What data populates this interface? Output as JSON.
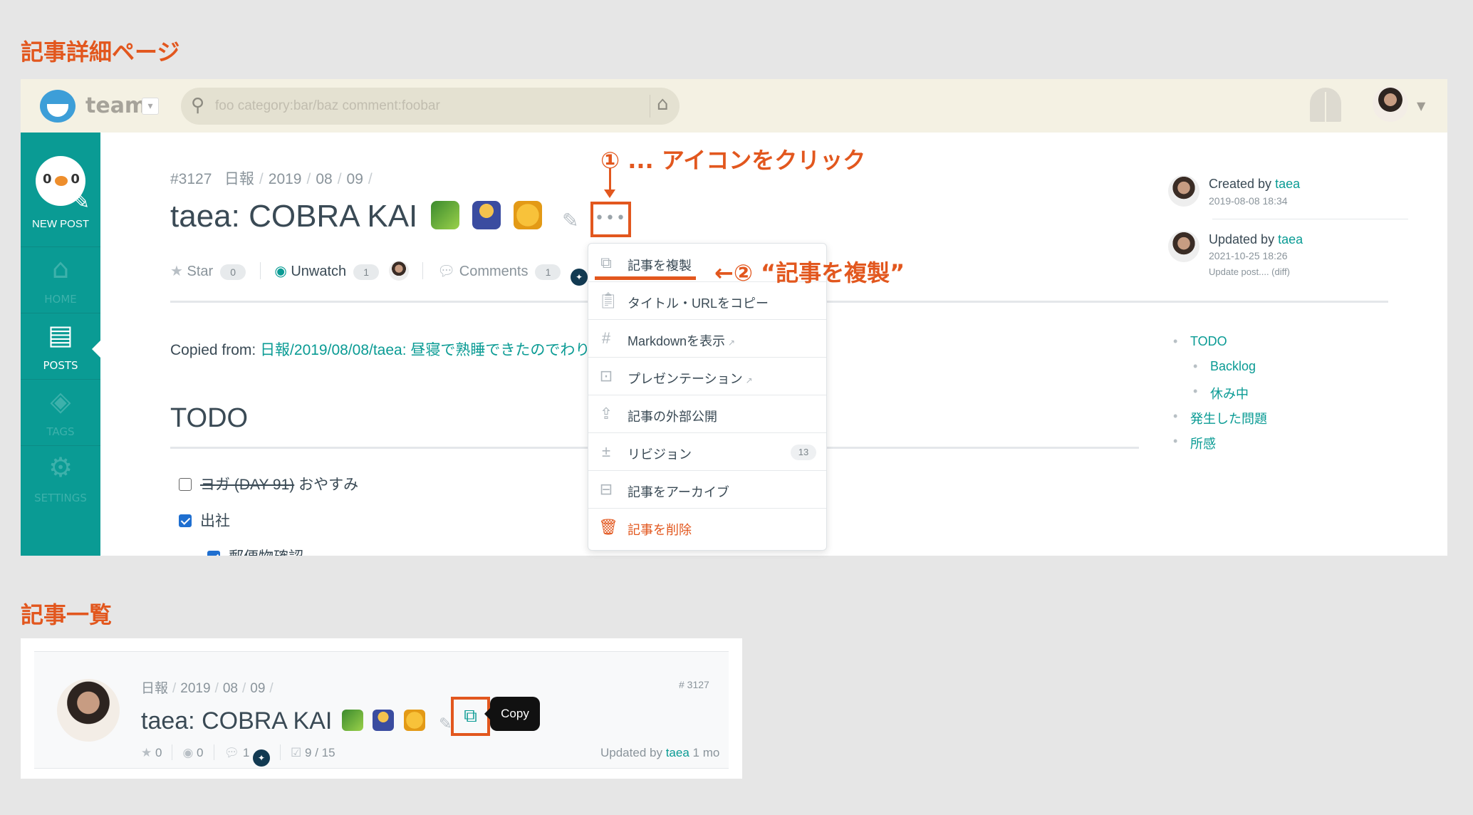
{
  "sections": {
    "detail_title": "記事詳細ページ",
    "list_title": "記事一覧"
  },
  "header": {
    "team": "team",
    "search_placeholder": "foo category:bar/baz comment:foobar"
  },
  "sidebar": {
    "new_post": "NEW POST",
    "items": [
      {
        "label": "HOME",
        "icon": "home-icon"
      },
      {
        "label": "POSTS",
        "icon": "document-icon",
        "active": true
      },
      {
        "label": "TAGS",
        "icon": "tags-icon"
      },
      {
        "label": "SETTINGS",
        "icon": "gear-icon"
      }
    ]
  },
  "post": {
    "number": "#3127",
    "breadcrumb": [
      "日報",
      "2019",
      "08",
      "09"
    ],
    "title": "taea: COBRA KAI",
    "emojis": [
      "snake-emoji",
      "person-bowing-emoji",
      "fist-emoji"
    ],
    "star_label": "Star",
    "star_count": "0",
    "watch_label": "Unwatch",
    "watch_count": "1",
    "comments_label": "Comments",
    "comments_count": "1",
    "copied_from_label": "Copied from:",
    "copied_from_link": "日報/2019/08/08/taea: 昼寝で熟睡できたのでわり",
    "todo_heading": "TODO",
    "tasks": [
      {
        "text_strike": "ヨガ (DAY 91)",
        "text": " おやすみ",
        "checked": false
      },
      {
        "text": "出社",
        "checked": true
      },
      {
        "text": "郵便物確認",
        "checked": true
      }
    ]
  },
  "right_column": {
    "created_by_label": "Created by",
    "created_by_user": "taea",
    "created_at": "2019-08-08 18:34",
    "updated_by_label": "Updated by",
    "updated_by_user": "taea",
    "updated_at": "2021-10-25 18:26",
    "update_note": "Update post.... (diff)",
    "toc": [
      {
        "label": "TODO",
        "level": 1
      },
      {
        "label": "Backlog",
        "level": 2
      },
      {
        "label": "休み中",
        "level": 2
      },
      {
        "label": "発生した問題",
        "level": 1
      },
      {
        "label": "所感",
        "level": 1
      }
    ]
  },
  "menu": {
    "items": [
      {
        "label": "記事を複製",
        "icon": "duplicate-icon"
      },
      {
        "label": "タイトル・URLをコピー",
        "icon": "clipboard-icon"
      },
      {
        "label": "Markdownを表示",
        "icon": "hash-icon",
        "external": true
      },
      {
        "label": "プレゼンテーション",
        "icon": "presentation-icon",
        "external": true
      },
      {
        "label": "記事の外部公開",
        "icon": "share-icon"
      },
      {
        "label": "リビジョン",
        "icon": "revision-icon",
        "badge": "13"
      },
      {
        "label": "記事をアーカイブ",
        "icon": "archive-icon"
      },
      {
        "label": "記事を削除",
        "icon": "trash-icon",
        "danger": true
      }
    ]
  },
  "annotations": {
    "step1": "① ... アイコンをクリック",
    "step2": "←② “記事を複製”"
  },
  "list_card": {
    "breadcrumb": [
      "日報",
      "2019",
      "08",
      "09"
    ],
    "title": "taea: COBRA KAI",
    "number": "# 3127",
    "copy_tooltip": "Copy",
    "stars": "0",
    "watchers": "0",
    "comments": "1",
    "tasks": "9 / 15",
    "updated_by_label": "Updated by",
    "updated_by_user": "taea",
    "updated_ago": "1 mo"
  },
  "colors": {
    "accent": "#e2571e",
    "brand": "#0a9b94",
    "topbar": "#f4f1e3"
  }
}
